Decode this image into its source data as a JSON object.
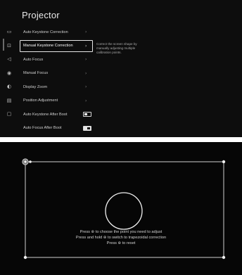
{
  "menu": {
    "title": "Projector",
    "items": [
      {
        "label": "Auto Keystone Correction",
        "icon": "keystone-icon",
        "glyph": "▭",
        "control": "chevron",
        "selected": false
      },
      {
        "label": "Manual Keystone Correction",
        "icon": "manual-keystone-icon",
        "glyph": "⊡",
        "control": "chevron",
        "selected": true
      },
      {
        "label": "Auto Focus",
        "icon": "auto-focus-icon",
        "glyph": "◁",
        "control": "chevron",
        "selected": false
      },
      {
        "label": "Manual Focus",
        "icon": "manual-focus-icon",
        "glyph": "◉",
        "control": "chevron",
        "selected": false
      },
      {
        "label": "Display Zoom",
        "icon": "display-zoom-icon",
        "glyph": "◐",
        "control": "chevron",
        "selected": false
      },
      {
        "label": "Position Adjustment",
        "icon": "position-adjustment-icon",
        "glyph": "▤",
        "control": "chevron",
        "selected": false
      },
      {
        "label": "Auto Keystone After Boot",
        "icon": "boot-keystone-icon",
        "glyph": "▢",
        "control": "toggle",
        "toggle_on": false,
        "selected": false
      },
      {
        "label": "Auto Focus After Boot",
        "icon": "",
        "glyph": "",
        "control": "toggle",
        "toggle_on": true,
        "selected": false
      }
    ],
    "chevron_glyph": "›",
    "description": "Correct the screen shape by manually adjusting multiple calibration points."
  },
  "keystone": {
    "instructions": [
      {
        "before": "Press ",
        "glyph": "⊛",
        "after": " to choose the point you need to adjust"
      },
      {
        "before": "Press and hold ",
        "glyph": "⊛",
        "after": " to switch to trapezoidal correction"
      },
      {
        "before": "Press ",
        "glyph": "⊛",
        "after": " to reset"
      }
    ]
  },
  "colors": {
    "menu_background": "#0d0d0d",
    "keystone_background": "#060606",
    "frame_line": "#e6e6e6",
    "text": "#d6d6d6"
  }
}
